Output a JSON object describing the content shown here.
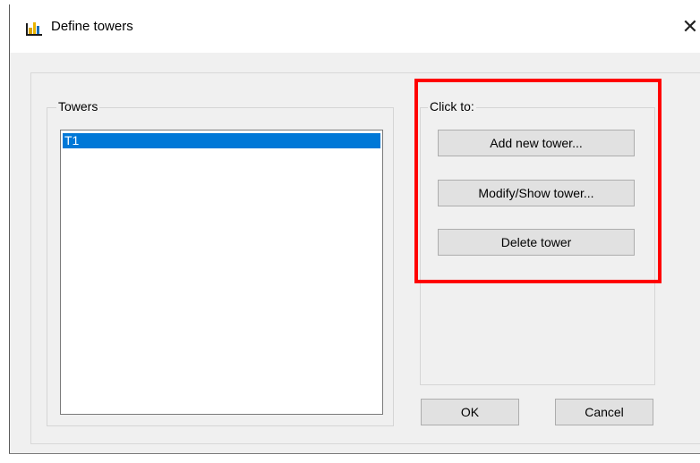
{
  "window": {
    "title": "Define towers",
    "close_glyph": "✕",
    "icon": "bar-chart-app-icon"
  },
  "towers_group": {
    "label": "Towers",
    "items": [
      {
        "label": "T1",
        "selected": true
      }
    ]
  },
  "actions_group": {
    "label": "Click to:",
    "buttons": {
      "add": "Add new tower...",
      "modify": "Modify/Show tower...",
      "delete": "Delete tower"
    }
  },
  "footer": {
    "ok": "OK",
    "cancel": "Cancel"
  },
  "colors": {
    "selection": "#0078d7",
    "annotation_highlight": "#ff0000",
    "dialog_bg": "#f0f0f0"
  }
}
